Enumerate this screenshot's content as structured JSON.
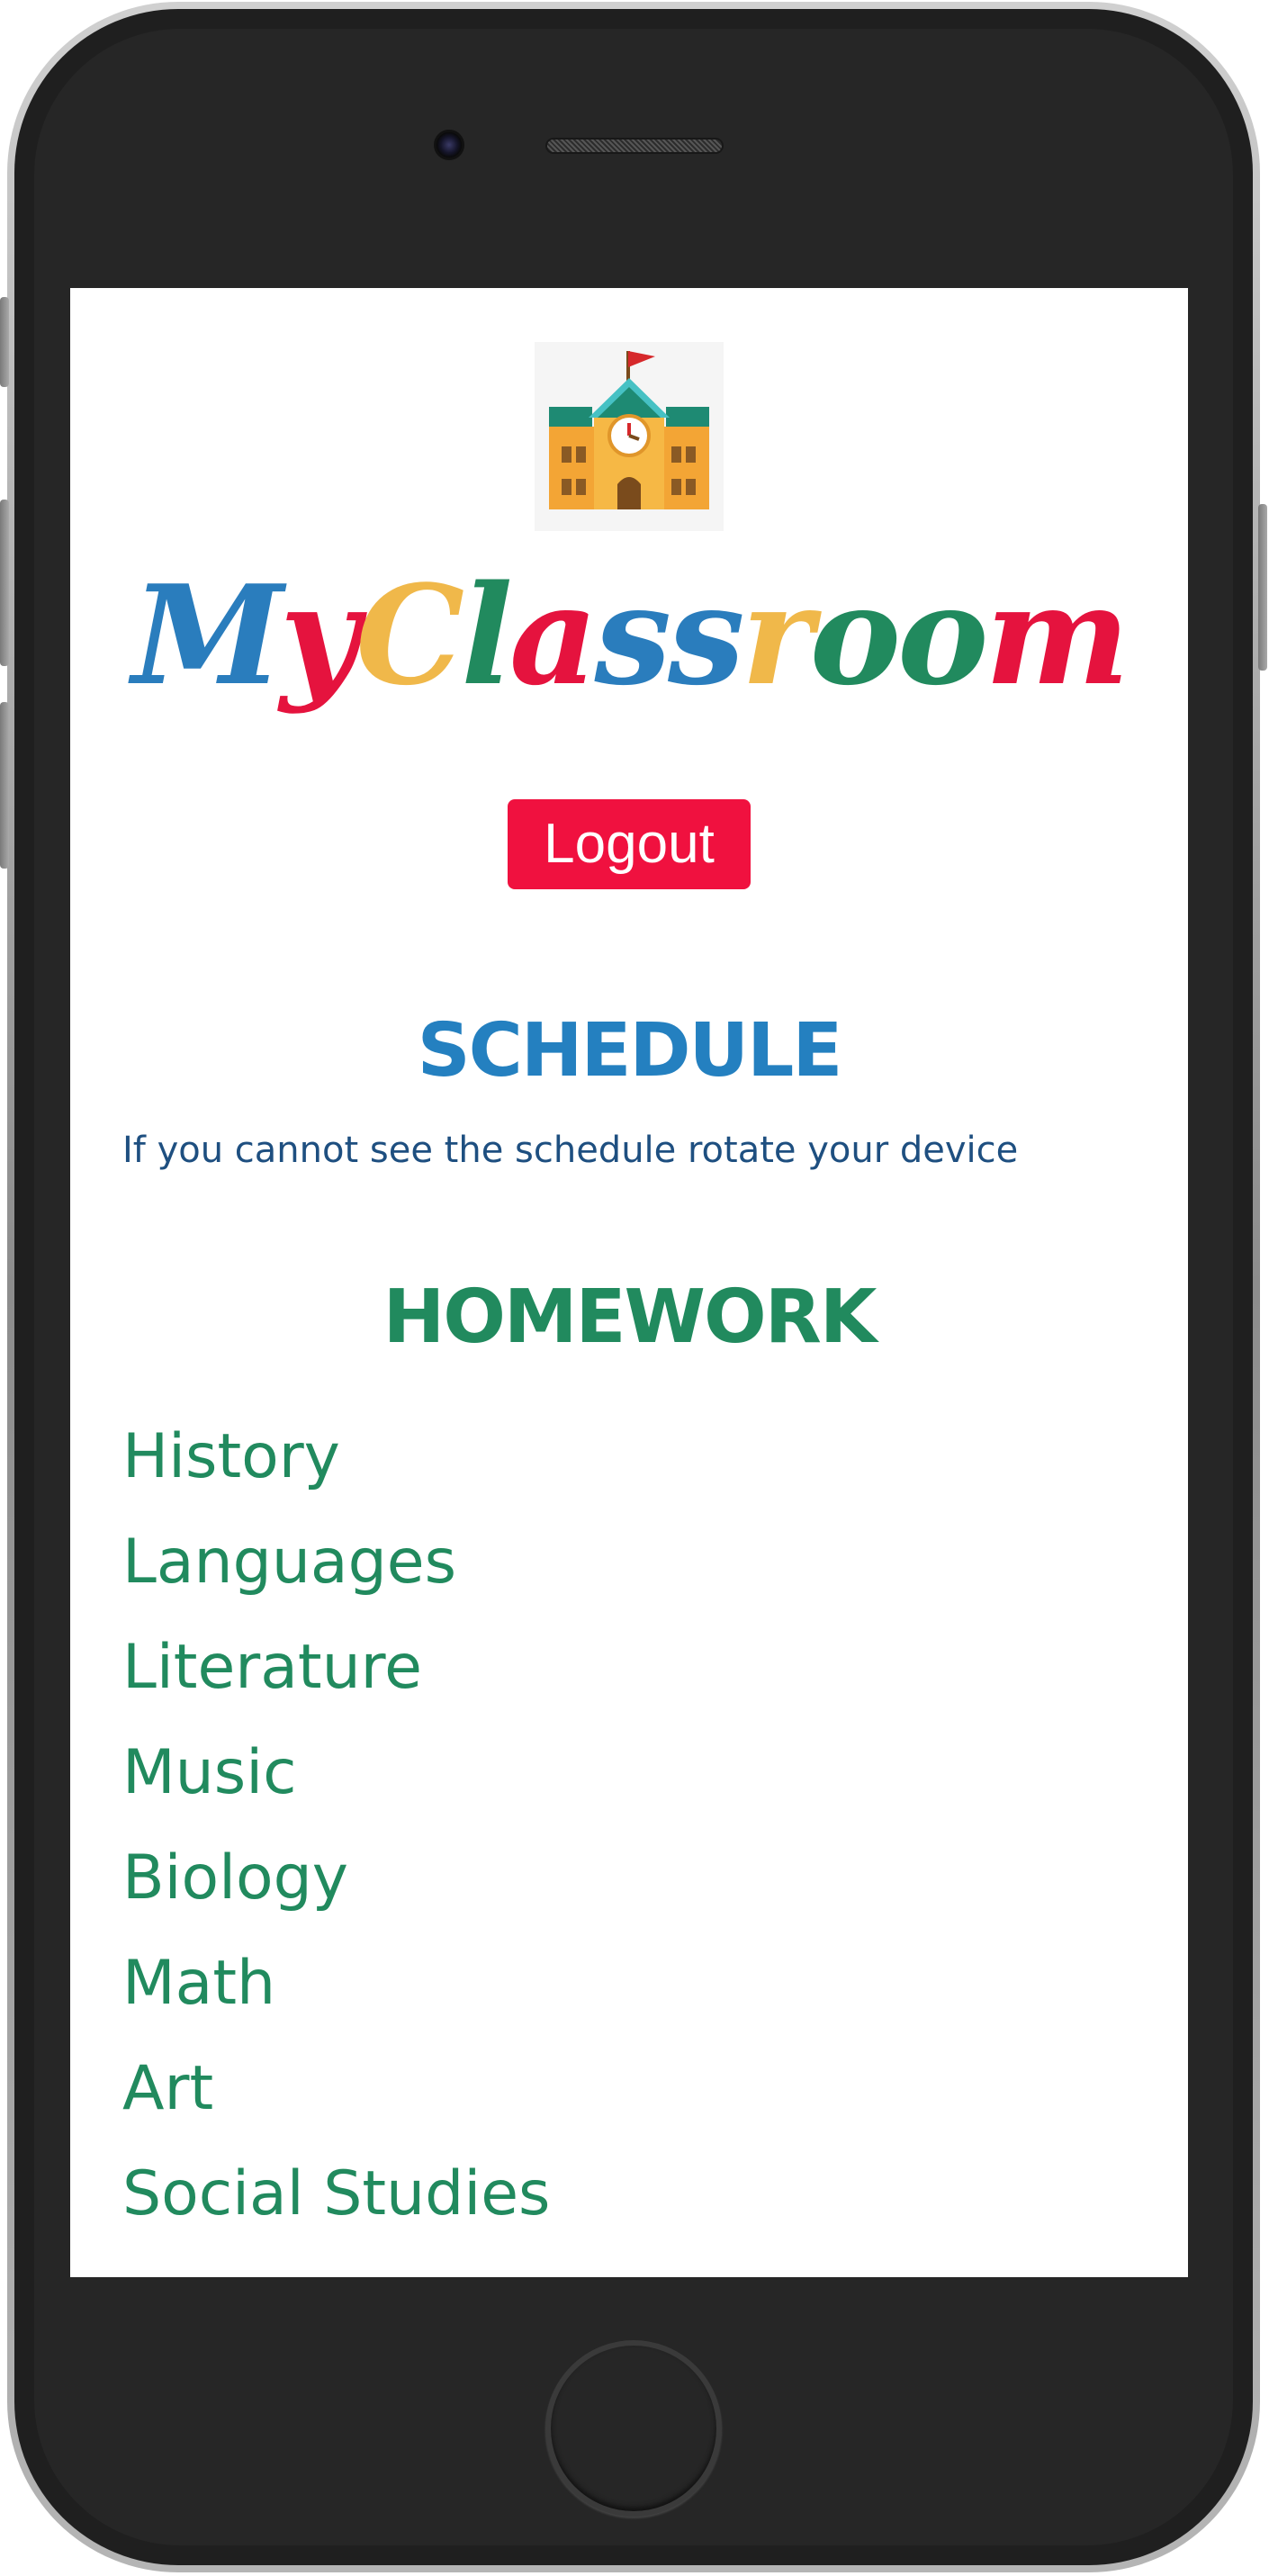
{
  "app": {
    "brand_letters": [
      {
        "char": "M",
        "color": "#2a7dbd"
      },
      {
        "char": "y",
        "color": "#e5133e"
      },
      {
        "char": "C",
        "color": "#f0b84a"
      },
      {
        "char": "l",
        "color": "#218a5e"
      },
      {
        "char": "a",
        "color": "#e5133e"
      },
      {
        "char": "s",
        "color": "#2a7dbd"
      },
      {
        "char": "s",
        "color": "#2a7dbd"
      },
      {
        "char": "r",
        "color": "#f0b84a"
      },
      {
        "char": "o",
        "color": "#218a5e"
      },
      {
        "char": "o",
        "color": "#218a5e"
      },
      {
        "char": "m",
        "color": "#e5133e"
      }
    ],
    "logo_icon": "school-building-icon"
  },
  "header": {
    "logout_label": "Logout"
  },
  "schedule": {
    "title": "SCHEDULE",
    "note": "If you cannot see the schedule rotate your device"
  },
  "homework": {
    "title": "HOMEWORK",
    "subjects": [
      "History",
      "Languages",
      "Literature",
      "Music",
      "Biology",
      "Math",
      "Art",
      "Social Studies"
    ]
  },
  "colors": {
    "accent_red": "#f0113f",
    "schedule_blue": "#2480c0",
    "homework_green": "#218a5e",
    "note_navy": "#1e4f80"
  }
}
